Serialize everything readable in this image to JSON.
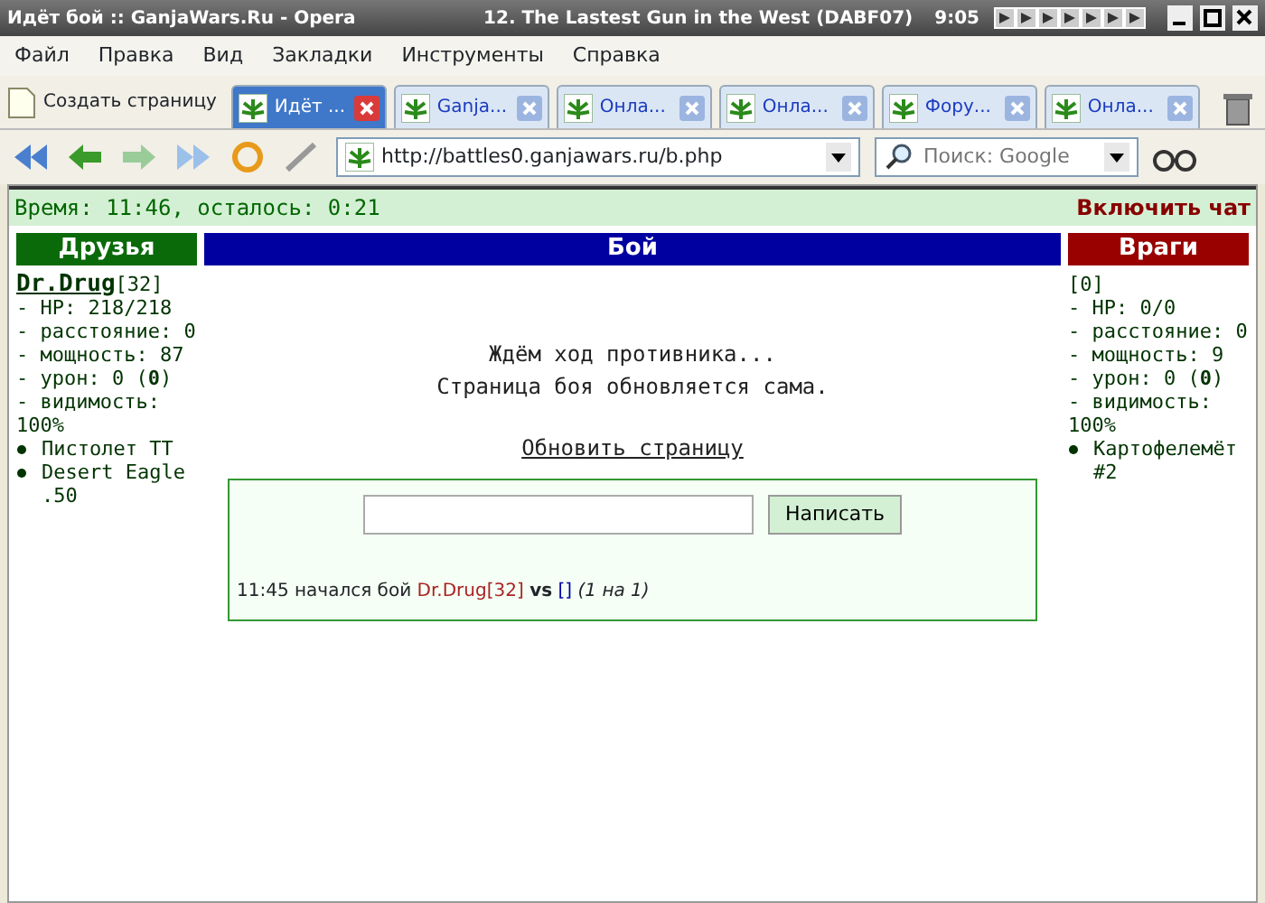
{
  "window": {
    "title": "Идёт бой :: GanjaWars.Ru - Opera",
    "media_title": "12. The Lastest Gun in the West (DABF07)",
    "clock": "9:05"
  },
  "menu": [
    "Файл",
    "Правка",
    "Вид",
    "Закладки",
    "Инструменты",
    "Справка"
  ],
  "new_page": "Создать страницу",
  "tabs": [
    {
      "label": "Идёт ...",
      "selected": true
    },
    {
      "label": "Ganja...",
      "selected": false
    },
    {
      "label": "Онла...",
      "selected": false
    },
    {
      "label": "Онла...",
      "selected": false
    },
    {
      "label": "Фору...",
      "selected": false
    },
    {
      "label": "Онла...",
      "selected": false
    }
  ],
  "address": {
    "url": "http://battles0.ganjawars.ru/b.php"
  },
  "search": {
    "placeholder": "Поиск: Google"
  },
  "battle": {
    "timer": "Время: 11:46, осталось:  0:21",
    "chat_link": "Включить чат",
    "headers": {
      "friends": "Друзья",
      "battle": "Бой",
      "enemies": "Враги"
    },
    "friend": {
      "name": "Dr.Drug",
      "level": "[32]",
      "stats": [
        "- HP: 218/218",
        "- расстояние: 0",
        "- мощность: 87",
        "- урон: 0 (**0**)",
        "- видимость: 100%"
      ],
      "weapons": [
        "Пистолет TT",
        "Desert Eagle .50"
      ]
    },
    "enemy": {
      "level": "[0]",
      "stats": [
        "- HP: 0/0",
        "- расстояние: 0",
        "- мощность: 9",
        "- урон: 0 (**0**)",
        "- видимость: 100%"
      ],
      "weapons": [
        "Картофелемёт #2"
      ]
    },
    "status": [
      "Ждём ход противника...",
      "Страница боя обновляется сама."
    ],
    "refresh_link": "Обновить страницу",
    "send_button": "Написать",
    "log": {
      "time": "11:45",
      "text": "начался бой",
      "player": "Dr.Drug[32]",
      "vs": "vs",
      "opponent": "[]",
      "mode": "(1 на 1)"
    }
  }
}
